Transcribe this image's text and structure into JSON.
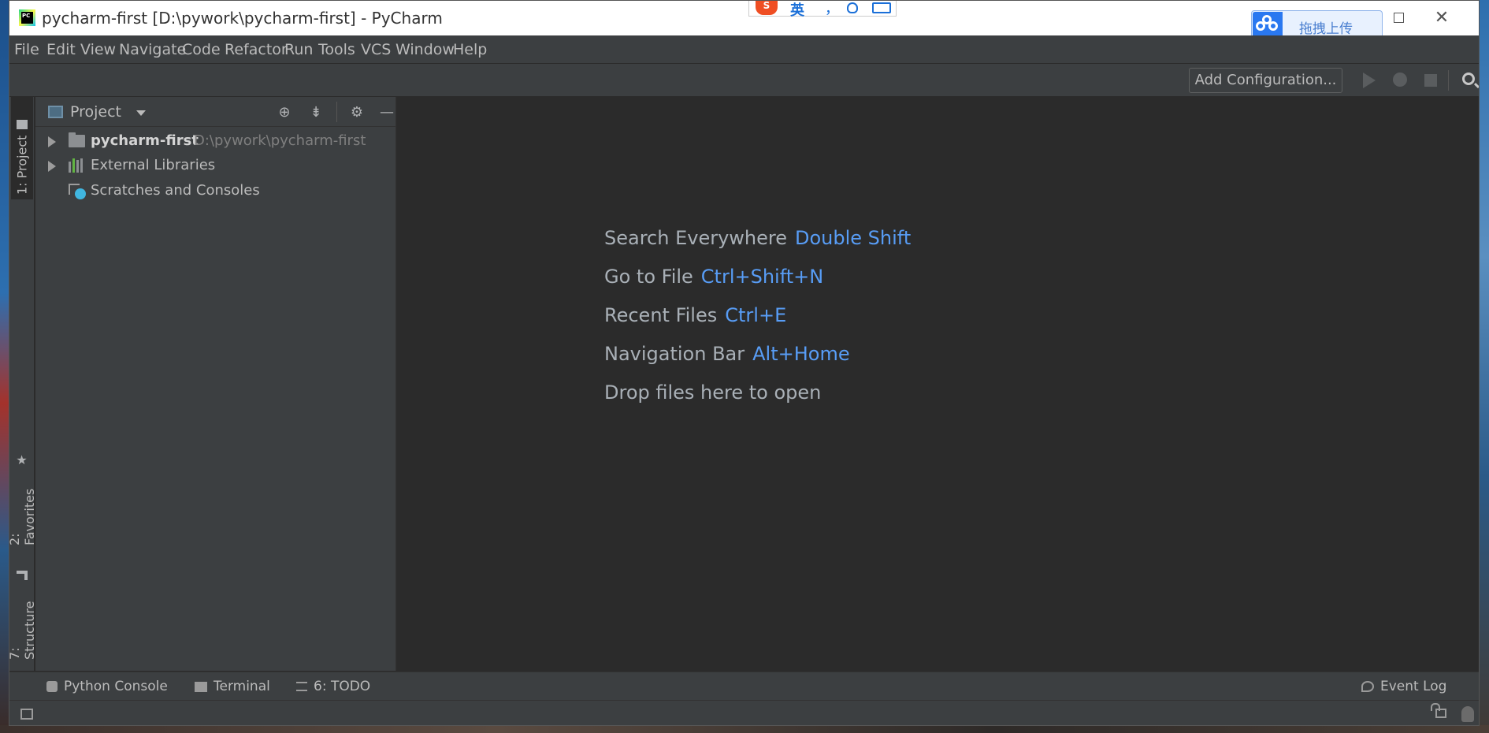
{
  "window": {
    "title": "pycharm-first [D:\\pywork\\pycharm-first] - PyCharm",
    "logo_text": "PC"
  },
  "ime": {
    "lang": "英",
    "punct": "，"
  },
  "upload": {
    "label": "拖拽上传"
  },
  "menu": {
    "items": [
      "File",
      "Edit",
      "View",
      "Navigate",
      "Code",
      "Refactor",
      "Run",
      "Tools",
      "VCS",
      "Window",
      "Help"
    ]
  },
  "toolbar": {
    "add_configuration": "Add Configuration..."
  },
  "left_stripe": {
    "project": "1: Project",
    "favorites": "2: Favorites",
    "structure": "7: Structure"
  },
  "project_panel": {
    "title": "Project",
    "tree": [
      {
        "label": "pycharm-first",
        "path": "D:\\pywork\\pycharm-first"
      },
      {
        "label": "External Libraries"
      },
      {
        "label": "Scratches and Consoles"
      }
    ]
  },
  "editor": {
    "hints": [
      {
        "action": "Search Everywhere",
        "shortcut": "Double Shift"
      },
      {
        "action": "Go to File",
        "shortcut": "Ctrl+Shift+N"
      },
      {
        "action": "Recent Files",
        "shortcut": "Ctrl+E"
      },
      {
        "action": "Navigation Bar",
        "shortcut": "Alt+Home"
      },
      {
        "action": "Drop files here to open",
        "shortcut": ""
      }
    ]
  },
  "bottom_tools": {
    "python_console": "Python Console",
    "terminal": "Terminal",
    "todo": "6: TODO",
    "event_log": "Event Log"
  },
  "colors": {
    "background": "#2b2b2b",
    "panel": "#3c3f41",
    "text": "#bbbbbb",
    "shortcut": "#589df6"
  }
}
